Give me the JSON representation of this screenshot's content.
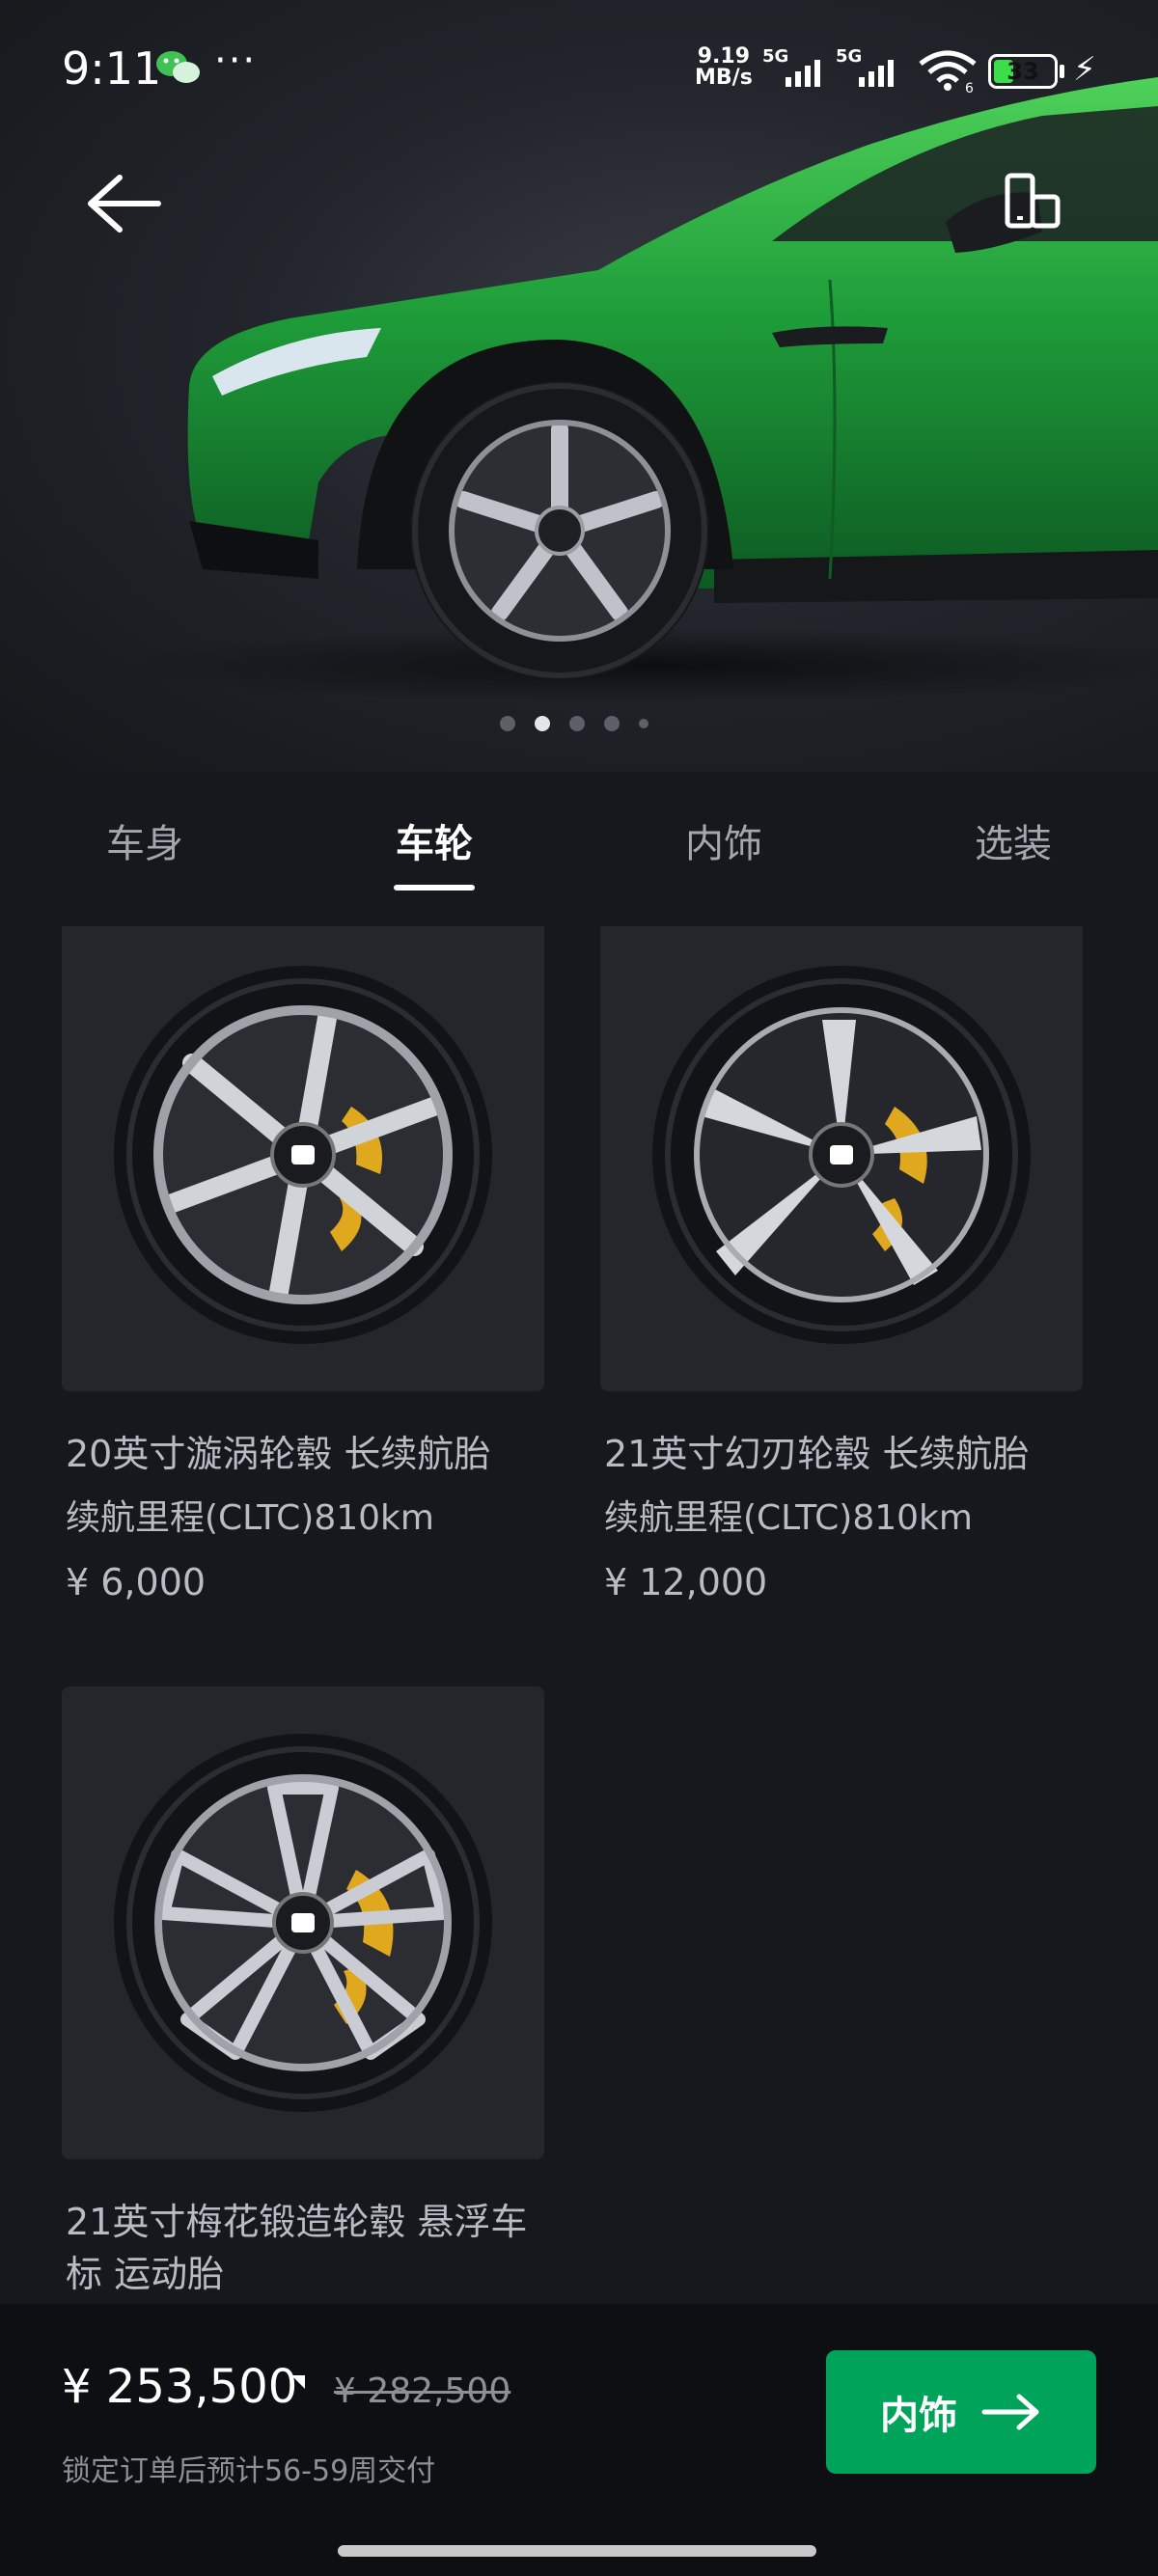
{
  "status_bar": {
    "time": "9:11",
    "more": "···",
    "net_speed_value": "9.19",
    "net_speed_unit": "MB/s",
    "sim1": "5G",
    "sim2": "5G",
    "wifi_badge": "6",
    "battery": "33",
    "battery_level": 0.33
  },
  "hero": {
    "car_color": "#1f9e3a",
    "carousel_pages": 5,
    "carousel_active": 1
  },
  "tabs": [
    {
      "label": "车身",
      "active": false
    },
    {
      "label": "车轮",
      "active": true
    },
    {
      "label": "内饰",
      "active": false
    },
    {
      "label": "选装",
      "active": false
    }
  ],
  "wheels": [
    {
      "title": "20英寸漩涡轮毂 长续航胎",
      "subtitle": "续航里程(CLTC)810km",
      "price": "¥ 6,000"
    },
    {
      "title": "21英寸幻刃轮毂 长续航胎",
      "subtitle": "续航里程(CLTC)810km",
      "price": "¥ 12,000"
    },
    {
      "title": "21英寸梅花锻造轮毂 悬浮车标 运动胎",
      "subtitle": "",
      "price": ""
    }
  ],
  "bottom": {
    "price": "¥ 253,500",
    "original_price": "¥ 282,500",
    "delivery": "锁定订单后预计56-59周交付",
    "next_label": "内饰",
    "accent": "#00a35a"
  }
}
